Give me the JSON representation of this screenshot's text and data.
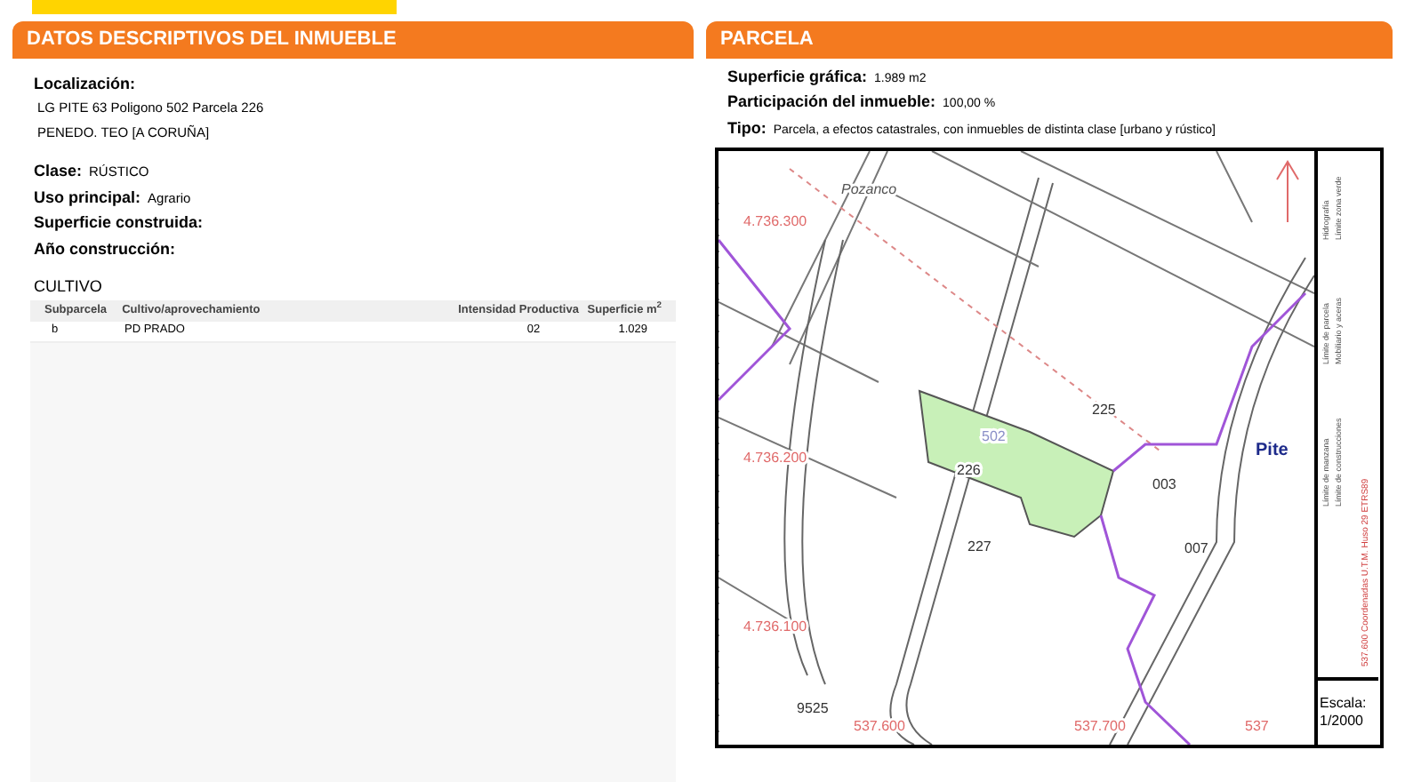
{
  "left_panel": {
    "title": "DATOS DESCRIPTIVOS DEL INMUEBLE",
    "location": {
      "label": "Localización:",
      "lines": [
        "LG PITE 63 Poligono 502 Parcela 226",
        "PENEDO. TEO [A CORUÑA]"
      ]
    },
    "fields": [
      {
        "label": "Clase:",
        "value": "RÚSTICO"
      },
      {
        "label": "Uso principal:",
        "value": "Agrario"
      },
      {
        "label": "Superficie construida:"
      },
      {
        "label": "Año construcción:"
      }
    ],
    "cultivo": {
      "title": "CULTIVO",
      "columns": [
        "Subparcela",
        "Cultivo/aprovechamiento",
        "Intensidad Productiva",
        "Superficie m$^{2}$"
      ],
      "rows": [
        [
          "b",
          "PD PRADO",
          "02",
          "1.029"
        ]
      ]
    }
  },
  "right_panel": {
    "title": "PARCELA",
    "fields": [
      {
        "label": "Superficie gráfica:",
        "value": "1.989 m2"
      },
      {
        "label": "Participación del inmueble:",
        "value": "100,00 %"
      },
      {
        "label": "Tipo:",
        "value": "Parcela, a efectos catastrales, con inmuebles de distinta clase [urbano y rústico]"
      }
    ],
    "map": {
      "labels": [
        {
          "kind": "place",
          "text": "Pozanco"
        },
        {
          "kind": "parcel",
          "text": "225"
        },
        {
          "kind": "polygon",
          "text": "502"
        },
        {
          "kind": "parcel",
          "text": "226"
        },
        {
          "kind": "parcel",
          "text": "003"
        },
        {
          "kind": "parcel",
          "text": "227"
        },
        {
          "kind": "parcel",
          "text": "007"
        },
        {
          "kind": "town",
          "text": "Pite"
        },
        {
          "kind": "coord",
          "text": "4.736.300"
        },
        {
          "kind": "coord",
          "text": "4.736.200"
        },
        {
          "kind": "coord",
          "text": "4.736.100"
        },
        {
          "kind": "parcel",
          "text": "9525"
        },
        {
          "kind": "coord",
          "text": "537.600"
        },
        {
          "kind": "coord",
          "text": "537.700"
        },
        {
          "kind": "coord",
          "text": "537"
        }
      ],
      "legend": [
        "Límite de manzana",
        "Límite de construcciones",
        "Límite de parcela",
        "Mobiliario y aceras",
        "Hidrografía",
        "Límite zona verde"
      ],
      "coordinates_note": "537.600 Coordenadas U.T.M. Huso 29 ETRS89",
      "scale_label": "Escala:",
      "scale_value": "1/2000"
    }
  }
}
